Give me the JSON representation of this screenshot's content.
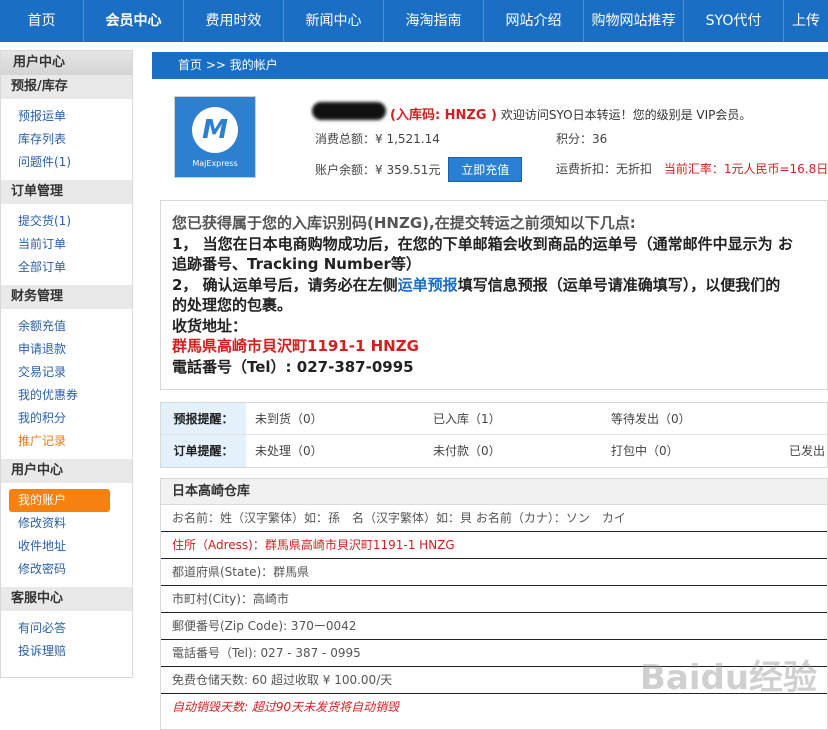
{
  "nav": {
    "items": [
      "首页",
      "会员中心",
      "费用时效",
      "新闻中心",
      "海淘指南",
      "网站介绍",
      "购物网站推荐",
      "SYO代付",
      "上传"
    ]
  },
  "sidebar": {
    "title": "用户中心",
    "groups": [
      {
        "heading": "预报/库存",
        "items": [
          "预报运单",
          "库存列表",
          "问题件(1)"
        ]
      },
      {
        "heading": "订单管理",
        "items": [
          "提交货(1)",
          "当前订单",
          "全部订单"
        ]
      },
      {
        "heading": "财务管理",
        "items": [
          "余额充值",
          "申请退款",
          "交易记录",
          "我的优惠券",
          "我的积分",
          "推广记录"
        ]
      },
      {
        "heading": "用户中心",
        "items": [
          "我的账户",
          "修改资料",
          "收件地址",
          "修改密码"
        ]
      },
      {
        "heading": "客服中心",
        "items": [
          "有问必答",
          "投诉理赔"
        ]
      }
    ]
  },
  "breadcrumb": "首页 >> 我的帐户",
  "account": {
    "logo_text": "MajExpress",
    "logo_mark": "M",
    "code_label": "(入库码: HNZG )",
    "welcome": "欢迎访问SYO日本转运！您的级别是 VIP会员。",
    "total_spent": "消费总额：¥ 1,521.14",
    "points": "积分：36",
    "balance": "账户余额：¥ 359.51元",
    "recharge_button": "立即充值",
    "discount": "运费折扣：无折扣",
    "rate": "当前汇率：1元人民币=16.8日"
  },
  "notice": {
    "line1": "您已获得属于您的入库识别码(HNZG),在提交转运之前须知以下几点:",
    "line2": "1， 当您在日本电商购物成功后，在您的下单邮箱会收到商品的运单号（通常邮件中显示为 お",
    "line3": "追跡番号、Tracking Number等）",
    "line4_a": "2， 确认运单号后，请务必在左侧",
    "line4_link": "运单预报",
    "line4_b": "填写信息预报（运单号请准确填写），以便我们的",
    "line5": "的处理您的包裹。",
    "line6": "收货地址：",
    "line7": "群馬県高崎市貝沢町1191-1 HNZG",
    "line8": "電話番号（Tel）: 027-387-0995"
  },
  "reminders": {
    "forecast_label": "预报提醒：",
    "forecast": [
      "未到货（0）",
      "已入库（1）",
      "等待发出（0）"
    ],
    "order_label": "订单提醒：",
    "order": [
      "未处理（0）",
      "未付款（0）",
      "打包中（0）",
      "已发出"
    ]
  },
  "warehouse": {
    "title": "日本高崎仓库",
    "lines": [
      "お名前：姓（汉字繁体）如：孫　名（汉字繁体）如：貝 お名前（カナ）：ソン　カイ",
      "住所（Adress)：群馬県高崎市貝沢町1191-1 HNZG",
      "都道府県(State)：群馬県",
      "市町村(City)：高崎市",
      "郵便番号(Zip Code): 370ー0042",
      "電話番号（Tel): 027 - 387 - 0995",
      "免费仓储天数: 60 超过收取 ¥ 100.00/天",
      "自动销毁天数: 超过90天未发货将自动销毁"
    ]
  },
  "watermark": "Baidu经验"
}
